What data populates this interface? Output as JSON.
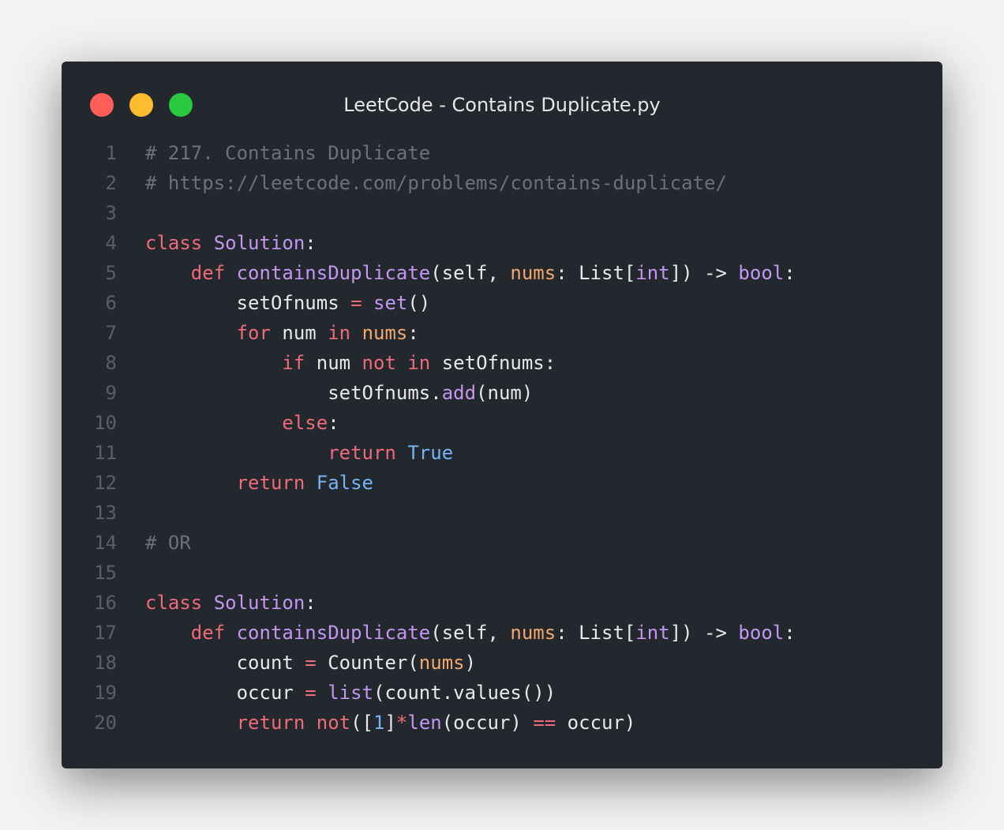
{
  "window": {
    "title": "LeetCode - Contains Duplicate.py",
    "controls": [
      {
        "name": "close",
        "color": "#ff5f57"
      },
      {
        "name": "minimize",
        "color": "#febc2e"
      },
      {
        "name": "maximize",
        "color": "#28c840"
      }
    ]
  },
  "code": {
    "language": "python",
    "lines": [
      {
        "number": "1",
        "tokens": [
          {
            "t": "# 217. Contains Duplicate",
            "c": "comment"
          }
        ]
      },
      {
        "number": "2",
        "tokens": [
          {
            "t": "# https://leetcode.com/problems/contains-duplicate/",
            "c": "comment"
          }
        ]
      },
      {
        "number": "3",
        "tokens": []
      },
      {
        "number": "4",
        "tokens": [
          {
            "t": "class",
            "c": "keyword"
          },
          {
            "t": " ",
            "c": "text"
          },
          {
            "t": "Solution",
            "c": "class"
          },
          {
            "t": ":",
            "c": "text"
          }
        ]
      },
      {
        "number": "5",
        "tokens": [
          {
            "t": "    ",
            "c": "text"
          },
          {
            "t": "def",
            "c": "keyword"
          },
          {
            "t": " ",
            "c": "text"
          },
          {
            "t": "containsDuplicate",
            "c": "func"
          },
          {
            "t": "(self, ",
            "c": "text"
          },
          {
            "t": "nums",
            "c": "param"
          },
          {
            "t": ": List[",
            "c": "text"
          },
          {
            "t": "int",
            "c": "builtin"
          },
          {
            "t": "]) -> ",
            "c": "text"
          },
          {
            "t": "bool",
            "c": "builtin"
          },
          {
            "t": ":",
            "c": "text"
          }
        ]
      },
      {
        "number": "6",
        "tokens": [
          {
            "t": "        setOfnums ",
            "c": "text"
          },
          {
            "t": "=",
            "c": "op"
          },
          {
            "t": " ",
            "c": "text"
          },
          {
            "t": "set",
            "c": "builtin"
          },
          {
            "t": "()",
            "c": "text"
          }
        ]
      },
      {
        "number": "7",
        "tokens": [
          {
            "t": "        ",
            "c": "text"
          },
          {
            "t": "for",
            "c": "keyword"
          },
          {
            "t": " num ",
            "c": "text"
          },
          {
            "t": "in",
            "c": "keyword"
          },
          {
            "t": " ",
            "c": "text"
          },
          {
            "t": "nums",
            "c": "param"
          },
          {
            "t": ":",
            "c": "text"
          }
        ]
      },
      {
        "number": "8",
        "tokens": [
          {
            "t": "            ",
            "c": "text"
          },
          {
            "t": "if",
            "c": "keyword"
          },
          {
            "t": " num ",
            "c": "text"
          },
          {
            "t": "not",
            "c": "keyword"
          },
          {
            "t": " ",
            "c": "text"
          },
          {
            "t": "in",
            "c": "keyword"
          },
          {
            "t": " setOfnums:",
            "c": "text"
          }
        ]
      },
      {
        "number": "9",
        "tokens": [
          {
            "t": "                setOfnums.",
            "c": "text"
          },
          {
            "t": "add",
            "c": "func"
          },
          {
            "t": "(num)",
            "c": "text"
          }
        ]
      },
      {
        "number": "10",
        "tokens": [
          {
            "t": "            ",
            "c": "text"
          },
          {
            "t": "else",
            "c": "keyword"
          },
          {
            "t": ":",
            "c": "text"
          }
        ]
      },
      {
        "number": "11",
        "tokens": [
          {
            "t": "                ",
            "c": "text"
          },
          {
            "t": "return",
            "c": "keyword"
          },
          {
            "t": " ",
            "c": "text"
          },
          {
            "t": "True",
            "c": "const"
          }
        ]
      },
      {
        "number": "12",
        "tokens": [
          {
            "t": "        ",
            "c": "text"
          },
          {
            "t": "return",
            "c": "keyword"
          },
          {
            "t": " ",
            "c": "text"
          },
          {
            "t": "False",
            "c": "const"
          }
        ]
      },
      {
        "number": "13",
        "tokens": []
      },
      {
        "number": "14",
        "tokens": [
          {
            "t": "# OR",
            "c": "comment"
          }
        ]
      },
      {
        "number": "15",
        "tokens": []
      },
      {
        "number": "16",
        "tokens": [
          {
            "t": "class",
            "c": "keyword"
          },
          {
            "t": " ",
            "c": "text"
          },
          {
            "t": "Solution",
            "c": "class"
          },
          {
            "t": ":",
            "c": "text"
          }
        ]
      },
      {
        "number": "17",
        "tokens": [
          {
            "t": "    ",
            "c": "text"
          },
          {
            "t": "def",
            "c": "keyword"
          },
          {
            "t": " ",
            "c": "text"
          },
          {
            "t": "containsDuplicate",
            "c": "func"
          },
          {
            "t": "(self, ",
            "c": "text"
          },
          {
            "t": "nums",
            "c": "param"
          },
          {
            "t": ": List[",
            "c": "text"
          },
          {
            "t": "int",
            "c": "builtin"
          },
          {
            "t": "]) -> ",
            "c": "text"
          },
          {
            "t": "bool",
            "c": "builtin"
          },
          {
            "t": ":",
            "c": "text"
          }
        ]
      },
      {
        "number": "18",
        "tokens": [
          {
            "t": "        count ",
            "c": "text"
          },
          {
            "t": "=",
            "c": "op"
          },
          {
            "t": " Counter(",
            "c": "text"
          },
          {
            "t": "nums",
            "c": "param"
          },
          {
            "t": ")",
            "c": "text"
          }
        ]
      },
      {
        "number": "19",
        "tokens": [
          {
            "t": "        occur ",
            "c": "text"
          },
          {
            "t": "=",
            "c": "op"
          },
          {
            "t": " ",
            "c": "text"
          },
          {
            "t": "list",
            "c": "builtin"
          },
          {
            "t": "(count.values())",
            "c": "text"
          }
        ]
      },
      {
        "number": "20",
        "tokens": [
          {
            "t": "        ",
            "c": "text"
          },
          {
            "t": "return",
            "c": "keyword"
          },
          {
            "t": " ",
            "c": "text"
          },
          {
            "t": "not",
            "c": "keyword"
          },
          {
            "t": "([",
            "c": "text"
          },
          {
            "t": "1",
            "c": "const"
          },
          {
            "t": "]",
            "c": "text"
          },
          {
            "t": "*",
            "c": "op"
          },
          {
            "t": "len",
            "c": "builtin"
          },
          {
            "t": "(occur) ",
            "c": "text"
          },
          {
            "t": "==",
            "c": "op"
          },
          {
            "t": " occur)",
            "c": "text"
          }
        ]
      }
    ]
  }
}
